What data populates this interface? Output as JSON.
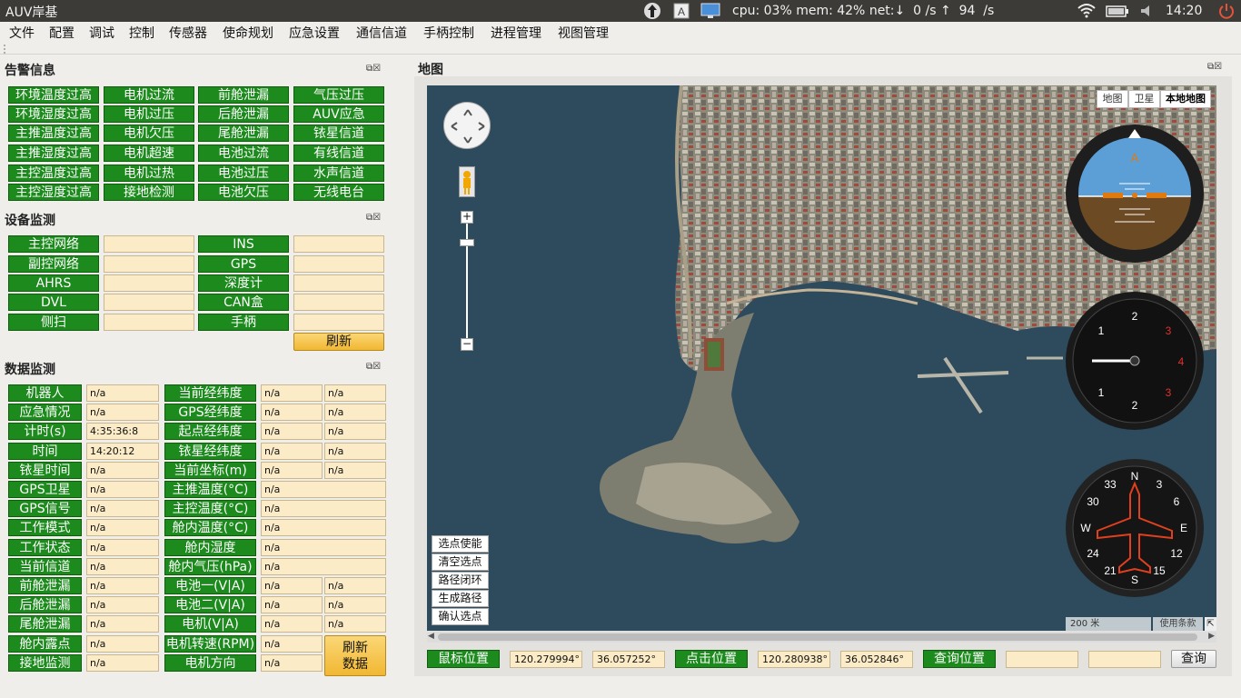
{
  "topbar": {
    "title": "AUV岸基",
    "stats": "cpu: 03% mem: 42% net:↓  0 /s ↑  94  /s",
    "clock": "14:20",
    "icons": [
      "upload-arrow-icon",
      "keyboard-a-icon",
      "display-icon",
      "wifi-icon",
      "battery-icon",
      "volume-icon",
      "power-icon"
    ]
  },
  "menu": [
    "文件",
    "配置",
    "调试",
    "控制",
    "传感器",
    "使命规划",
    "应急设置",
    "通信信道",
    "手柄控制",
    "进程管理",
    "视图管理"
  ],
  "alarm": {
    "title": "告警信息",
    "items": [
      "环境温度过高",
      "电机过流",
      "前舱泄漏",
      "气压过压",
      "环境湿度过高",
      "电机过压",
      "后舱泄漏",
      "AUV应急",
      "主推温度过高",
      "电机欠压",
      "尾舱泄漏",
      "铱星信道",
      "主推湿度过高",
      "电机超速",
      "电池过流",
      "有线信道",
      "主控温度过高",
      "电机过热",
      "电池过压",
      "水声信道",
      "主控湿度过高",
      "接地检测",
      "电池欠压",
      "无线电台"
    ]
  },
  "device": {
    "title": "设备监测",
    "rows": [
      [
        "主控网络",
        "INS"
      ],
      [
        "副控网络",
        "GPS"
      ],
      [
        "AHRS",
        "深度计"
      ],
      [
        "DVL",
        "CAN盒"
      ],
      [
        "侧扫",
        "手柄"
      ]
    ],
    "refresh": "刷新"
  },
  "data": {
    "title": "数据监测",
    "left": [
      {
        "label": "机器人",
        "value": "n/a"
      },
      {
        "label": "应急情况",
        "value": "n/a"
      },
      {
        "label": "计时(s)",
        "value": "4:35:36:8"
      },
      {
        "label": "时间",
        "value": "14:20:12"
      },
      {
        "label": "铱星时间",
        "value": "n/a"
      },
      {
        "label": "GPS卫星",
        "value": "n/a"
      },
      {
        "label": "GPS信号",
        "value": "n/a"
      },
      {
        "label": "工作模式",
        "value": "n/a"
      },
      {
        "label": "工作状态",
        "value": "n/a"
      },
      {
        "label": "当前信道",
        "value": "n/a"
      },
      {
        "label": "前舱泄漏",
        "value": "n/a"
      },
      {
        "label": "后舱泄漏",
        "value": "n/a"
      },
      {
        "label": "尾舱泄漏",
        "value": "n/a"
      },
      {
        "label": "舱内露点",
        "value": "n/a"
      },
      {
        "label": "接地监测",
        "value": "n/a"
      }
    ],
    "right": [
      {
        "label": "当前经纬度",
        "v1": "n/a",
        "v2": "n/a"
      },
      {
        "label": "GPS经纬度",
        "v1": "n/a",
        "v2": "n/a"
      },
      {
        "label": "起点经纬度",
        "v1": "n/a",
        "v2": "n/a"
      },
      {
        "label": "铱星经纬度",
        "v1": "n/a",
        "v2": "n/a"
      },
      {
        "label": "当前坐标(m)",
        "v1": "n/a",
        "v2": "n/a"
      },
      {
        "label": "主推温度(°C)",
        "v1": "n/a"
      },
      {
        "label": "主控温度(°C)",
        "v1": "n/a"
      },
      {
        "label": "舱内温度(°C)",
        "v1": "n/a"
      },
      {
        "label": "舱内湿度",
        "v1": "n/a"
      },
      {
        "label": "舱内气压(hPa)",
        "v1": "n/a"
      },
      {
        "label": "电池一(V|A)",
        "v1": "n/a",
        "v2": "n/a"
      },
      {
        "label": "电池二(V|A)",
        "v1": "n/a",
        "v2": "n/a"
      },
      {
        "label": "电机(V|A)",
        "v1": "n/a",
        "v2": "n/a"
      },
      {
        "label": "电机转速(RPM)",
        "v1": "n/a"
      },
      {
        "label": "电机方向",
        "v1": "n/a"
      }
    ],
    "refresh": [
      "刷新",
      "数据"
    ]
  },
  "map": {
    "title": "地图",
    "types": [
      "地图",
      "卫星",
      "本地地图"
    ],
    "actions": [
      "选点使能",
      "清空选点",
      "路径闭环",
      "生成路径",
      "确认选点"
    ],
    "scale": "200 米",
    "terms": "使用条款"
  },
  "bottom": {
    "mouse": "鼠标位置",
    "mouse_lon": "120.279994°",
    "mouse_lat": "36.057252°",
    "click": "点击位置",
    "click_lon": "120.280938°",
    "click_lat": "36.052846°",
    "query": "查询位置",
    "query_lon": "",
    "query_lat": "",
    "query_btn": "查询"
  },
  "instruments": {
    "attitude_mark": "A",
    "compass_labels": [
      "N",
      "3",
      "6",
      "E",
      "12",
      "15",
      "S",
      "21",
      "24",
      "W",
      "30",
      "33"
    ],
    "dial_numbers": [
      "2",
      "3",
      "4",
      "3",
      "2",
      "1",
      "1"
    ]
  }
}
